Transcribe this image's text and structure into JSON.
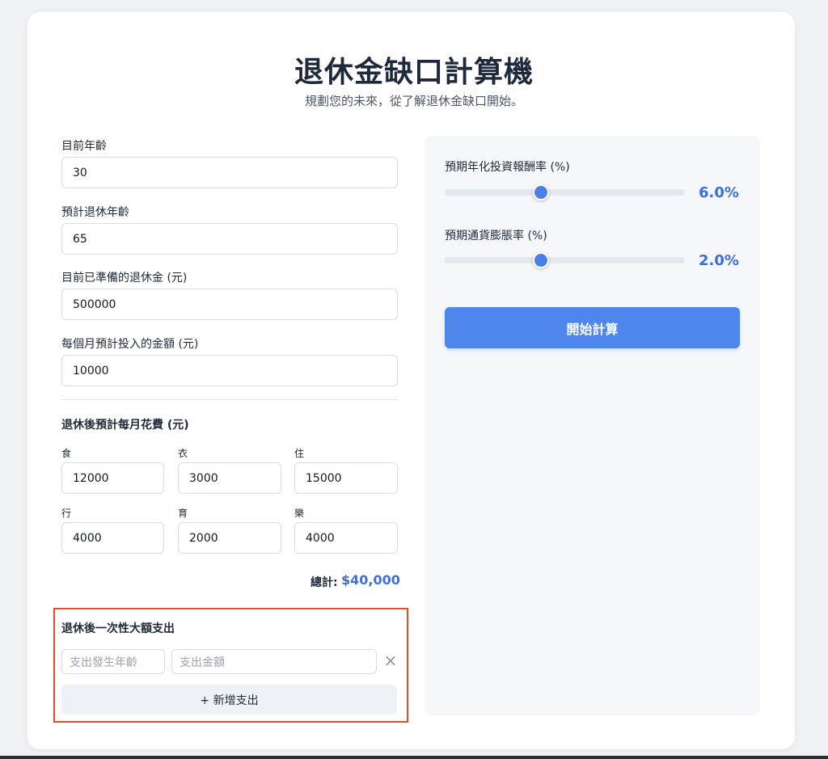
{
  "header": {
    "title": "退休金缺口計算機",
    "subtitle": "規劃您的未來，從了解退休金缺口開始。"
  },
  "form": {
    "current_age": {
      "label": "目前年齡",
      "value": "30"
    },
    "retire_age": {
      "label": "預計退休年齡",
      "value": "65"
    },
    "saved": {
      "label": "目前已準備的退休金 (元)",
      "value": "500000"
    },
    "monthly": {
      "label": "每個月預計投入的金額 (元)",
      "value": "10000"
    }
  },
  "expenses": {
    "section_label": "退休後預計每月花費 (元)",
    "items": [
      {
        "label": "食",
        "value": "12000"
      },
      {
        "label": "衣",
        "value": "3000"
      },
      {
        "label": "住",
        "value": "15000"
      },
      {
        "label": "行",
        "value": "4000"
      },
      {
        "label": "育",
        "value": "2000"
      },
      {
        "label": "樂",
        "value": "4000"
      }
    ],
    "total_label": "總計:",
    "total_value": "$40,000"
  },
  "lump": {
    "section_label": "退休後一次性大額支出",
    "age_placeholder": "支出發生年齡",
    "amount_placeholder": "支出金額",
    "remove_icon": "×",
    "add_label": "+ 新增支出"
  },
  "sliders": {
    "return_rate": {
      "label": "預期年化投資報酬率 (%)",
      "display": "6.0%",
      "value": 6.0,
      "fraction": 0.333
    },
    "inflation": {
      "label": "預期通貨膨脹率 (%)",
      "display": "2.0%",
      "value": 2.0,
      "fraction": 0.333
    }
  },
  "actions": {
    "calculate_label": "開始計算"
  },
  "colors": {
    "accent": "#4f86ee",
    "highlight": "#e64b2a",
    "total": "#3b6fd9"
  }
}
